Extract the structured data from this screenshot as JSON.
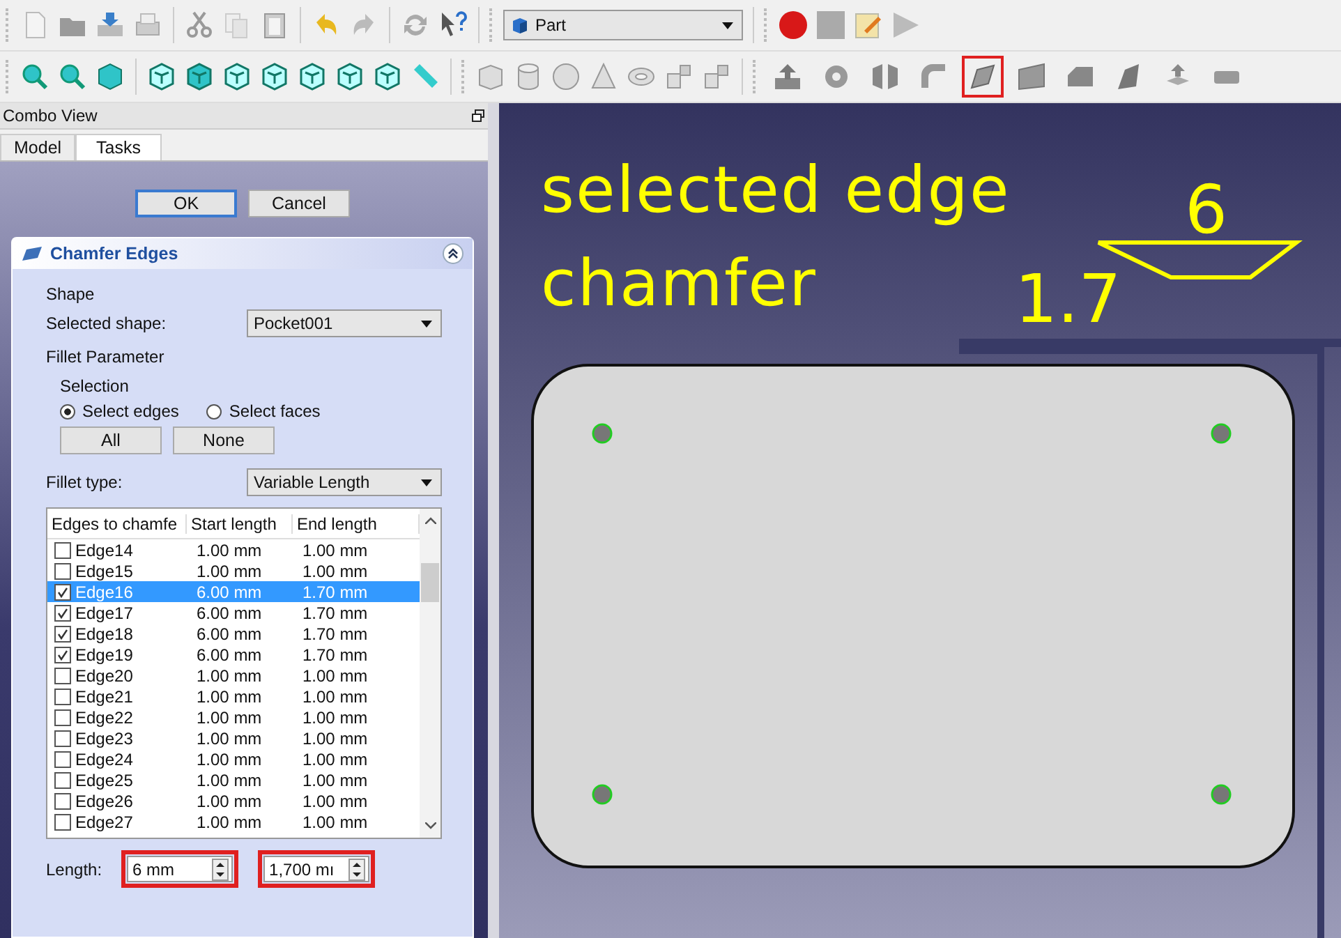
{
  "toolbar": {
    "workbench": "Part"
  },
  "part_tools": [
    {
      "kind": "extrude",
      "highlighted": false
    },
    {
      "kind": "revolve",
      "highlighted": false
    },
    {
      "kind": "mirror",
      "highlighted": false
    },
    {
      "kind": "fillet",
      "highlighted": false
    },
    {
      "kind": "chamfer",
      "highlighted": true
    },
    {
      "kind": "face",
      "highlighted": false
    },
    {
      "kind": "loft",
      "highlighted": false
    },
    {
      "kind": "sweep",
      "highlighted": false
    },
    {
      "kind": "offset",
      "highlighted": false
    },
    {
      "kind": "thickness",
      "highlighted": false
    }
  ],
  "combo_view": {
    "title": "Combo View",
    "tabs": [
      {
        "label": "Model",
        "selected": false
      },
      {
        "label": "Tasks",
        "selected": true
      }
    ]
  },
  "task": {
    "buttons": [
      {
        "label": "OK",
        "default": true
      },
      {
        "label": "Cancel",
        "default": false
      }
    ],
    "panel_title": "Chamfer Edges",
    "shape_group": "Shape",
    "selected_shape_label": "Selected shape:",
    "selected_shape": "Pocket001",
    "parameter_group": "Fillet Parameter",
    "selection_group": "Selection",
    "radios": [
      {
        "label": "Select edges",
        "selected": true
      },
      {
        "label": "Select faces",
        "selected": false
      }
    ],
    "selection_buttons": [
      "All",
      "None"
    ],
    "fillet_type_label": "Fillet type:",
    "fillet_type": "Variable Length",
    "table": {
      "columns": [
        "Edges to chamfe",
        "Start length",
        "End length"
      ],
      "rows": [
        {
          "edge": "Edge14",
          "checked": false,
          "selected": false,
          "start": "1.00 mm",
          "end": "1.00 mm"
        },
        {
          "edge": "Edge15",
          "checked": false,
          "selected": false,
          "start": "1.00 mm",
          "end": "1.00 mm"
        },
        {
          "edge": "Edge16",
          "checked": true,
          "selected": true,
          "start": "6.00 mm",
          "end": "1.70 mm"
        },
        {
          "edge": "Edge17",
          "checked": true,
          "selected": false,
          "start": "6.00 mm",
          "end": "1.70 mm"
        },
        {
          "edge": "Edge18",
          "checked": true,
          "selected": false,
          "start": "6.00 mm",
          "end": "1.70 mm"
        },
        {
          "edge": "Edge19",
          "checked": true,
          "selected": false,
          "start": "6.00 mm",
          "end": "1.70 mm"
        },
        {
          "edge": "Edge20",
          "checked": false,
          "selected": false,
          "start": "1.00 mm",
          "end": "1.00 mm"
        },
        {
          "edge": "Edge21",
          "checked": false,
          "selected": false,
          "start": "1.00 mm",
          "end": "1.00 mm"
        },
        {
          "edge": "Edge22",
          "checked": false,
          "selected": false,
          "start": "1.00 mm",
          "end": "1.00 mm"
        },
        {
          "edge": "Edge23",
          "checked": false,
          "selected": false,
          "start": "1.00 mm",
          "end": "1.00 mm"
        },
        {
          "edge": "Edge24",
          "checked": false,
          "selected": false,
          "start": "1.00 mm",
          "end": "1.00 mm"
        },
        {
          "edge": "Edge25",
          "checked": false,
          "selected": false,
          "start": "1.00 mm",
          "end": "1.00 mm"
        },
        {
          "edge": "Edge26",
          "checked": false,
          "selected": false,
          "start": "1.00 mm",
          "end": "1.00 mm"
        },
        {
          "edge": "Edge27",
          "checked": false,
          "selected": false,
          "start": "1.00 mm",
          "end": "1.00 mm"
        }
      ]
    },
    "length_label": "Length:",
    "length_fields": [
      {
        "value": "6 mm",
        "highlighted": true
      },
      {
        "value": "1,700 mı",
        "highlighted": true
      }
    ]
  },
  "viewport": {
    "caption_lines": [
      "selected edge",
      "chamfer"
    ],
    "start_dimension": "6",
    "end_dimension": "1.7"
  }
}
